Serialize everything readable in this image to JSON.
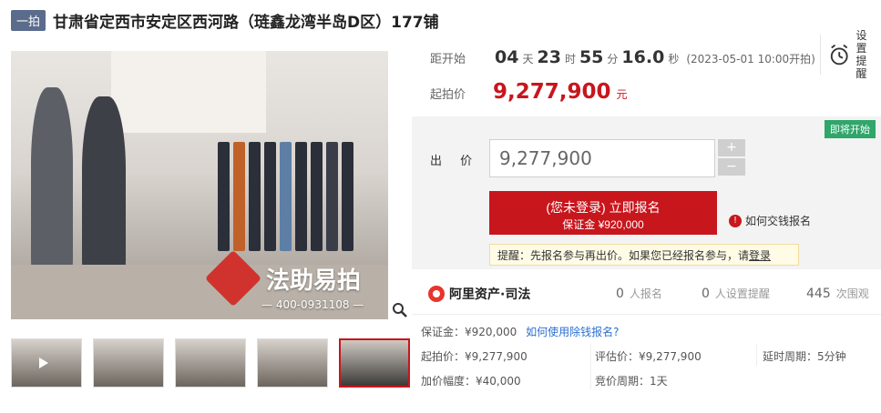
{
  "header": {
    "badge": "一拍",
    "title": "甘肃省定西市安定区西河路（琏鑫龙湾半岛D区）177铺"
  },
  "gallery": {
    "watermark_text": "法助易拍",
    "watermark_phone": "— 400-0931108 —",
    "thumbnails": [
      "thumb-1",
      "thumb-2",
      "thumb-3",
      "thumb-4",
      "thumb-5"
    ],
    "active_thumbnail_index": 4
  },
  "countdown": {
    "label": "距开始",
    "days": "04",
    "days_unit": "天",
    "hours": "23",
    "hours_unit": "时",
    "minutes": "55",
    "minutes_unit": "分",
    "seconds": "16.0",
    "seconds_unit": "秒",
    "start_text": "(2023-05-01 10:00开拍)"
  },
  "remind": {
    "line1": "设置",
    "line2": "提醒"
  },
  "start_price": {
    "label": "起拍价",
    "value": "9,277,900",
    "unit": "元"
  },
  "bid": {
    "status_tag": "即将开始",
    "label": "出 价",
    "value": "9,277,900",
    "plus": "+",
    "minus": "−",
    "enroll_line1": "(您未登录) 立即报名",
    "enroll_line2": "保证金 ¥920,000",
    "help_link": "如何交钱报名",
    "reminder_text": "提醒：先报名参与再出价。如果您已经报名参与，请",
    "reminder_link": "登录"
  },
  "stats": {
    "brand": "阿里资产·司法",
    "enrolled_count": "0",
    "enrolled_label": "人报名",
    "reminders_count": "0",
    "reminders_label": "人设置提醒",
    "views_count": "445",
    "views_label": "次围观"
  },
  "details": {
    "deposit": "保证金：¥920,000",
    "deposit_link": "如何使用除钱报名?",
    "start_price": "起拍价：¥9,277,900",
    "appraisal": "评估价：¥9,277,900",
    "delay": "延时周期：5分钟",
    "increment": "加价幅度：¥40,000",
    "cycle": "竞价周期：1天"
  },
  "colors": {
    "accent_red": "#c8161d",
    "status_green": "#2fa66a",
    "badge_blue": "#5a6b8c"
  }
}
